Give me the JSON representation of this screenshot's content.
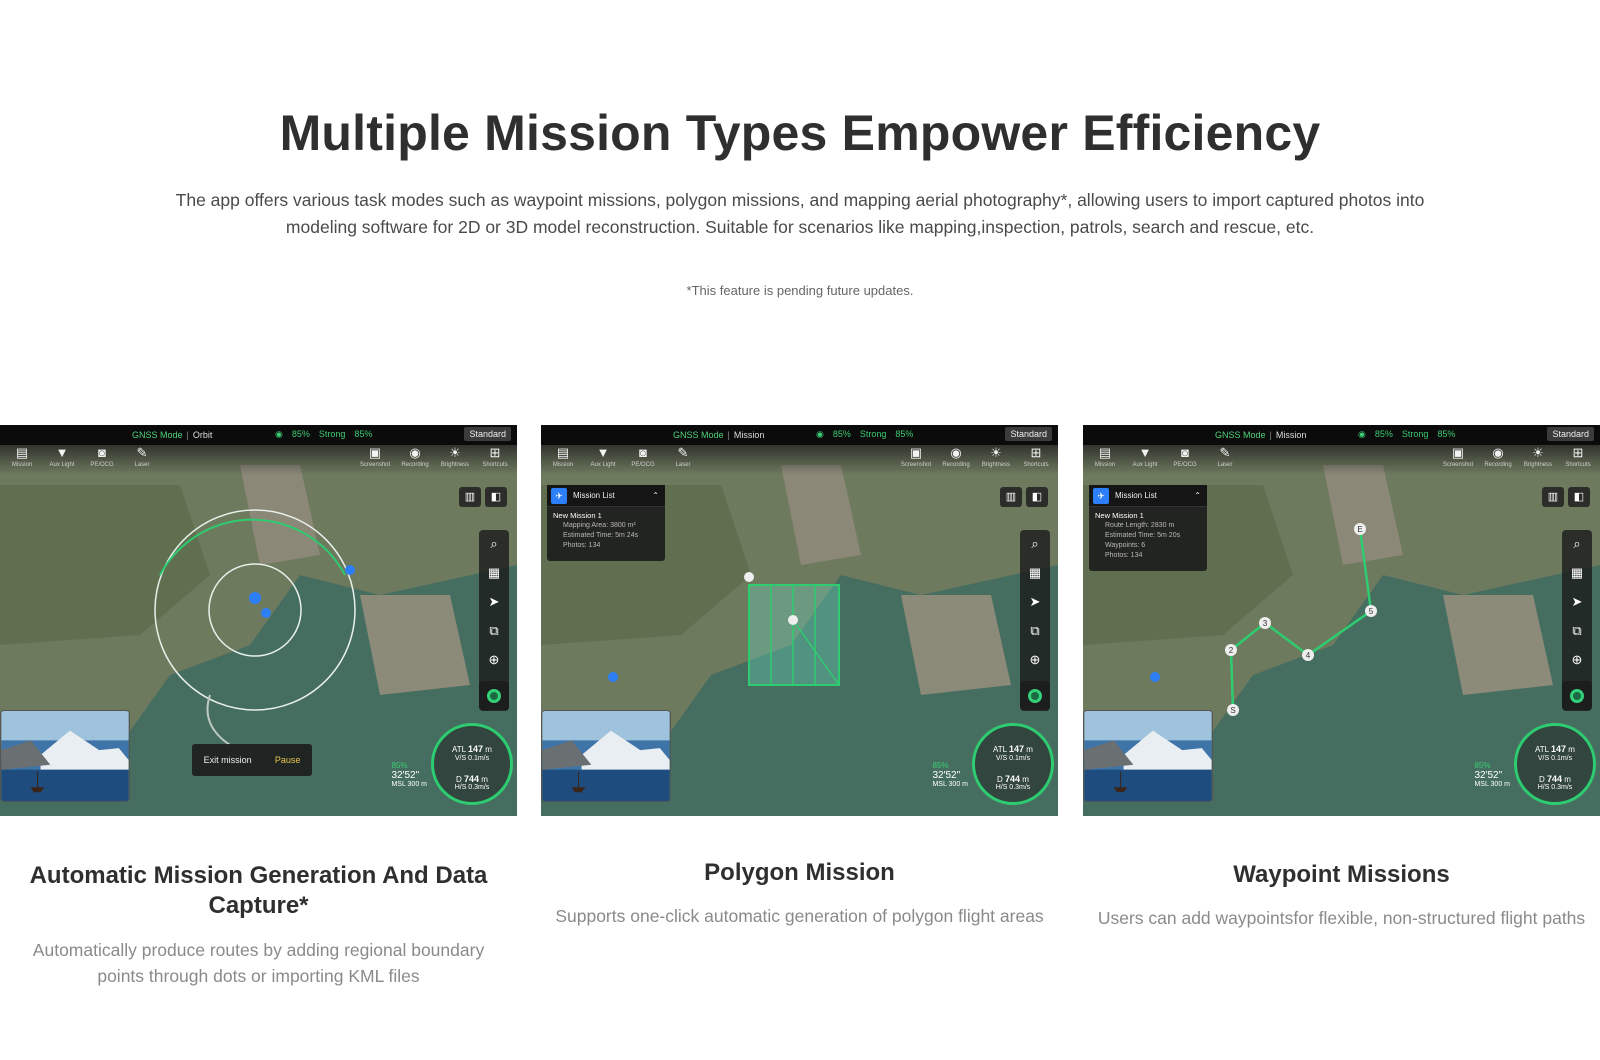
{
  "header": {
    "title": "Multiple Mission Types Empower Efficiency",
    "intro": "The app offers various task modes such as waypoint missions, polygon missions, and mapping aerial photography*, allowing users to import captured photos into modeling software for 2D or 3D model reconstruction. Suitable for scenarios like mapping,inspection, patrols, search and rescue, etc.",
    "note": "*This feature is pending future updates."
  },
  "toolbar_left": [
    {
      "label": "Mission",
      "icon": "mission-icon"
    },
    {
      "label": "Aux Light",
      "icon": "aux-light-icon"
    },
    {
      "label": "PE/OCG",
      "icon": "vehicle-icon"
    },
    {
      "label": "Laser",
      "icon": "laser-icon"
    }
  ],
  "toolbar_right": [
    {
      "label": "Screenshot",
      "icon": "screenshot-icon"
    },
    {
      "label": "Recording",
      "icon": "record-icon"
    },
    {
      "label": "Brightness",
      "icon": "brightness-icon"
    },
    {
      "label": "Shortcuts",
      "icon": "shortcuts-icon"
    }
  ],
  "status": {
    "gnss": "GNSS Mode",
    "stat1": "85%",
    "signal": "Strong",
    "stat2": "85%",
    "standard": "Standard"
  },
  "gauge": {
    "atl_label": "ATL",
    "atl_value": "147",
    "atl_unit": "m",
    "vs": "V/S 0.1m/s",
    "d_label": "D",
    "d_value": "744",
    "d_unit": "m",
    "hs": "H/S 0.3m/s"
  },
  "telemetry": {
    "battery": "85%",
    "time": "32'52\"",
    "msl": "MSL 300 m"
  },
  "cards": [
    {
      "mode": "Orbit",
      "title": "Automatic Mission Generation And Data Capture*",
      "desc": "Automatically produce routes by adding regional boundary points through dots or importing KML files",
      "exit_label": "Exit mission",
      "pause_label": "Pause"
    },
    {
      "mode": "Mission",
      "title": "Polygon Mission",
      "desc": "Supports one-click automatic generation of polygon flight areas",
      "panel": {
        "title": "Mission List",
        "name": "New Mission 1",
        "lines": [
          "Mapping Area: 3800 m²",
          "Estimated Time: 5m 24s",
          "Photos: 134"
        ]
      }
    },
    {
      "mode": "Mission",
      "title": "Waypoint Missions",
      "desc": "Users can add waypointsfor flexible, non-structured flight paths",
      "panel": {
        "title": "Mission List",
        "name": "New Mission 1",
        "lines": [
          "Route Length: 2830 m",
          "Estimated Time: 5m 20s",
          "Waypoints: 6",
          "Photos: 134"
        ]
      },
      "waypoints": [
        "S",
        "2",
        "3",
        "4",
        "5",
        "E"
      ]
    }
  ],
  "colors": {
    "accent_green": "#2ecc71",
    "title": "#2f2f2f",
    "desc": "#8a8a8a"
  }
}
